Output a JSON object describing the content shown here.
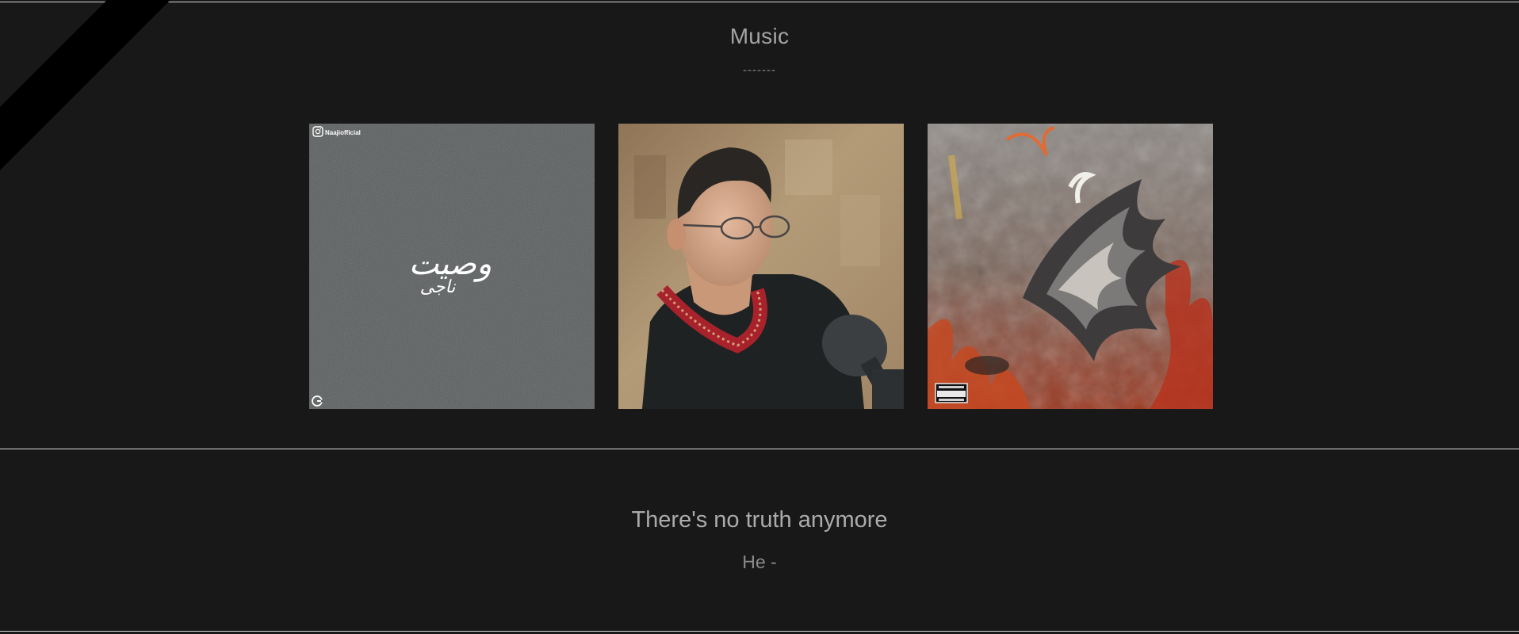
{
  "music": {
    "title": "Music",
    "divider": "-------"
  },
  "albums": [
    {
      "name": "vasiat-album-cover",
      "instagram_handle": "Naajiofficial",
      "calligraphy": "وصیت",
      "calligraphy_sub": "ناجی",
      "background_color": "#5a5d5e"
    },
    {
      "name": "man-with-microphone-photo",
      "background_color": "#a58a66"
    },
    {
      "name": "burning-bird-album-cover",
      "advisory_label": "PARENTAL ADVISORY EXPLICIT CONTENT",
      "background_color": "#7a5d4e"
    }
  ],
  "quote": {
    "text": "There's no truth anymore",
    "author": "He -"
  }
}
